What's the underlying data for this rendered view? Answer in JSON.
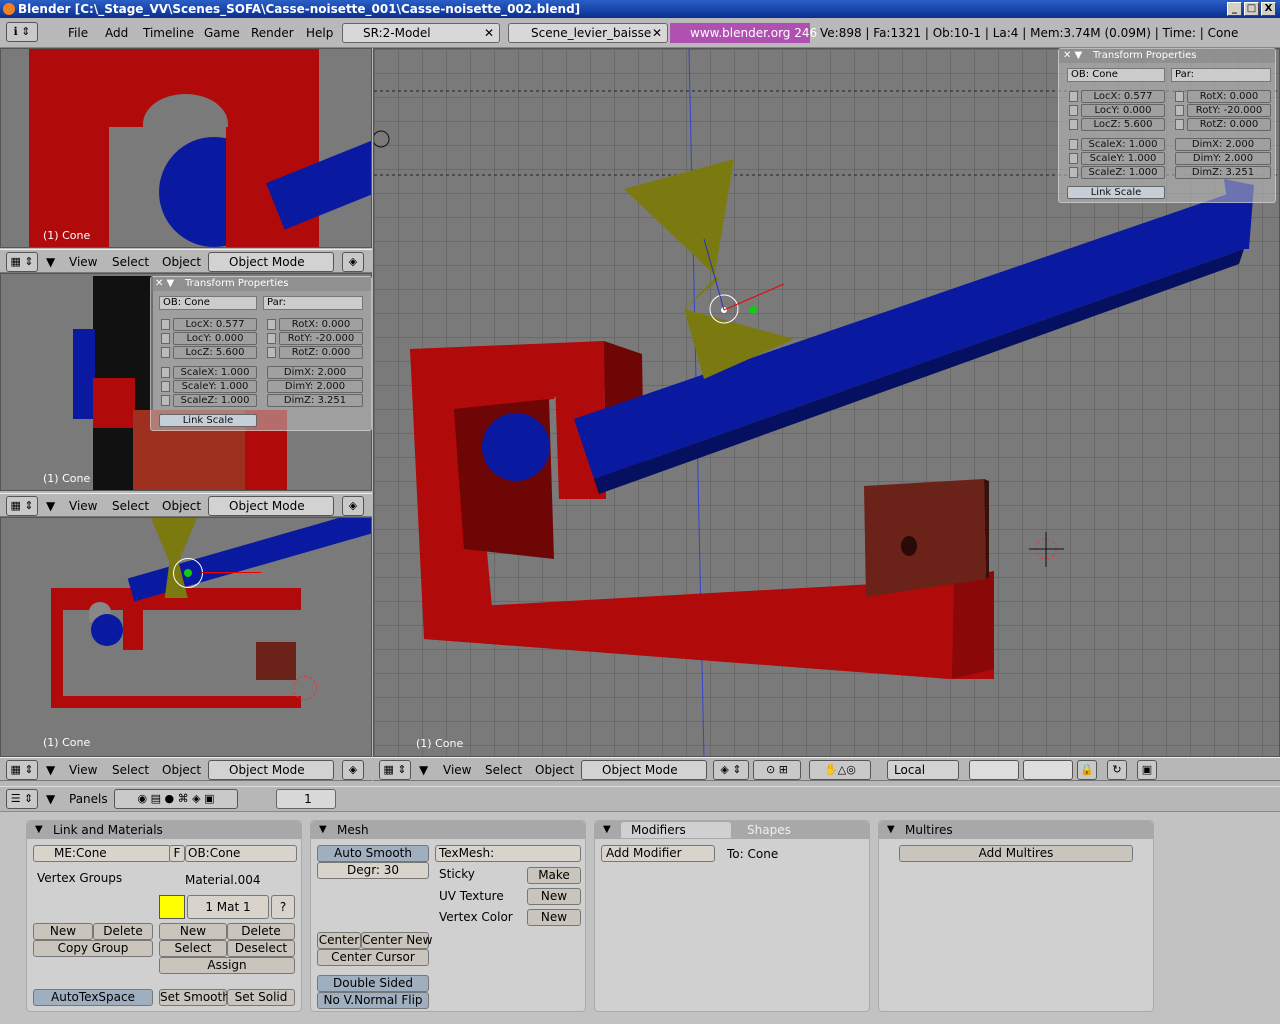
{
  "window": {
    "title": "Blender [C:\\_Stage_VV\\Scenes_SOFA\\Casse-noisette_001\\Casse-noisette_002.blend]",
    "buttons": [
      "_",
      "□",
      "X"
    ]
  },
  "menubar": {
    "menus": [
      "File",
      "Add",
      "Timeline",
      "Game",
      "Render",
      "Help"
    ],
    "screen": "SR:2-Model",
    "scene": "Scene_levier_baisse",
    "url": "www.blender.org 246",
    "stats": "Ve:898 | Fa:1321 | Ob:10-1 | La:4  | Mem:3.74M (0.09M)  | Time: | Cone"
  },
  "viewport": {
    "menus": [
      "View",
      "Select",
      "Object"
    ],
    "mode": "Object Mode",
    "object_label": "(1) Cone",
    "pivot": "Local"
  },
  "transform": {
    "title": "Transform Properties",
    "ob": "OB: Cone",
    "par": "Par:",
    "loc": [
      "LocX: 0.577",
      "LocY: 0.000",
      "LocZ: 5.600"
    ],
    "rot": [
      "RotX: 0.000",
      "RotY: -20.000",
      "RotZ: 0.000"
    ],
    "scale": [
      "ScaleX: 1.000",
      "ScaleY: 1.000",
      "ScaleZ: 1.000"
    ],
    "dim": [
      "DimX: 2.000",
      "DimY: 2.000",
      "DimZ: 3.251"
    ],
    "link_scale": "Link Scale"
  },
  "buttons_window": {
    "panels_label": "Panels",
    "page": "1"
  },
  "link_materials": {
    "title": "Link and Materials",
    "me": "ME:Cone",
    "f": "F",
    "ob": "OB:Cone",
    "vertex_groups": "Vertex Groups",
    "material": "Material.004",
    "mat_index": "1 Mat 1",
    "question": "?",
    "vg_new": "New",
    "vg_delete": "Delete",
    "copy_group": "Copy Group",
    "m_new": "New",
    "m_delete": "Delete",
    "m_select": "Select",
    "m_deselect": "Deselect",
    "assign": "Assign",
    "autotexspace": "AutoTexSpace",
    "set_smooth": "Set Smooth",
    "set_solid": "Set Solid",
    "swatch_color": "#ffff00"
  },
  "mesh": {
    "title": "Mesh",
    "auto_smooth": "Auto Smooth",
    "degr": "Degr: 30",
    "texmesh": "TexMesh:",
    "sticky": "Sticky",
    "make": "Make",
    "uv_texture": "UV Texture",
    "uv_new": "New",
    "vertex_color": "Vertex Color",
    "vc_new": "New",
    "center": "Center",
    "center_new": "Center New",
    "center_cursor": "Center Cursor",
    "double_sided": "Double Sided",
    "no_vnormal_flip": "No V.Normal Flip"
  },
  "modifiers": {
    "tab_modifiers": "Modifiers",
    "tab_shapes": "Shapes",
    "add_modifier": "Add Modifier",
    "to": "To: Cone"
  },
  "multires": {
    "title": "Multires",
    "add": "Add Multires"
  },
  "colors": {
    "red": "#b00a0a",
    "blue": "#0a1aa0",
    "olive": "#7a7a10",
    "brown": "#6b2218",
    "bg": "#7a7a7a"
  }
}
